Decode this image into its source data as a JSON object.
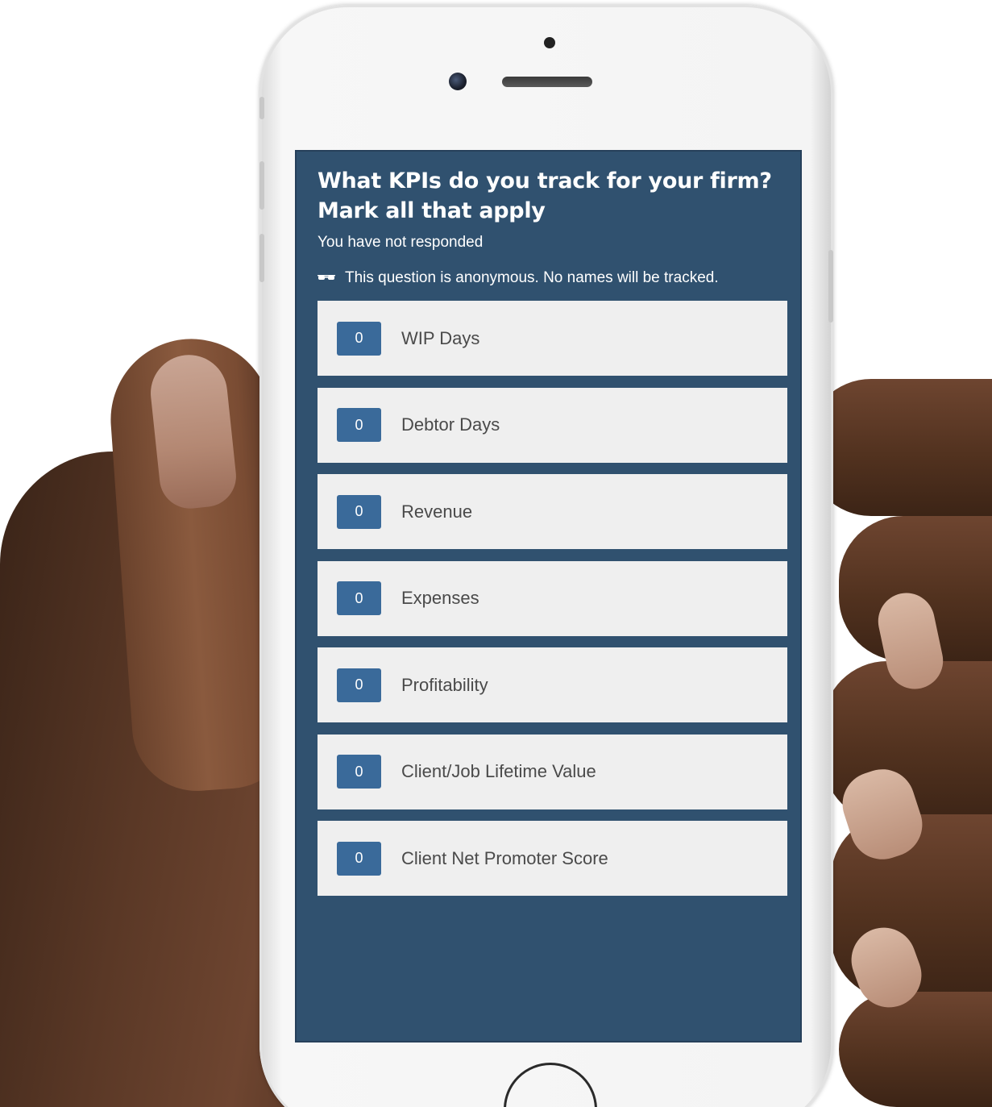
{
  "poll": {
    "question": "What KPIs do you track for your firm? Mark all that apply",
    "status": "You have not responded",
    "anonymous_notice": "This question is anonymous. No names will be tracked.",
    "anonymous_icon": "incognito-glasses-icon",
    "options": [
      {
        "label": "WIP Days",
        "count": "0"
      },
      {
        "label": "Debtor Days",
        "count": "0"
      },
      {
        "label": "Revenue",
        "count": "0"
      },
      {
        "label": "Expenses",
        "count": "0"
      },
      {
        "label": "Profitability",
        "count": "0"
      },
      {
        "label": "Client/Job Lifetime Value",
        "count": "0"
      },
      {
        "label": "Client Net Promoter Score",
        "count": "0"
      }
    ]
  },
  "colors": {
    "screen_background": "#30516f",
    "option_background": "#efefef",
    "count_badge": "#3a6a9a",
    "option_text": "#4a4a4a"
  }
}
